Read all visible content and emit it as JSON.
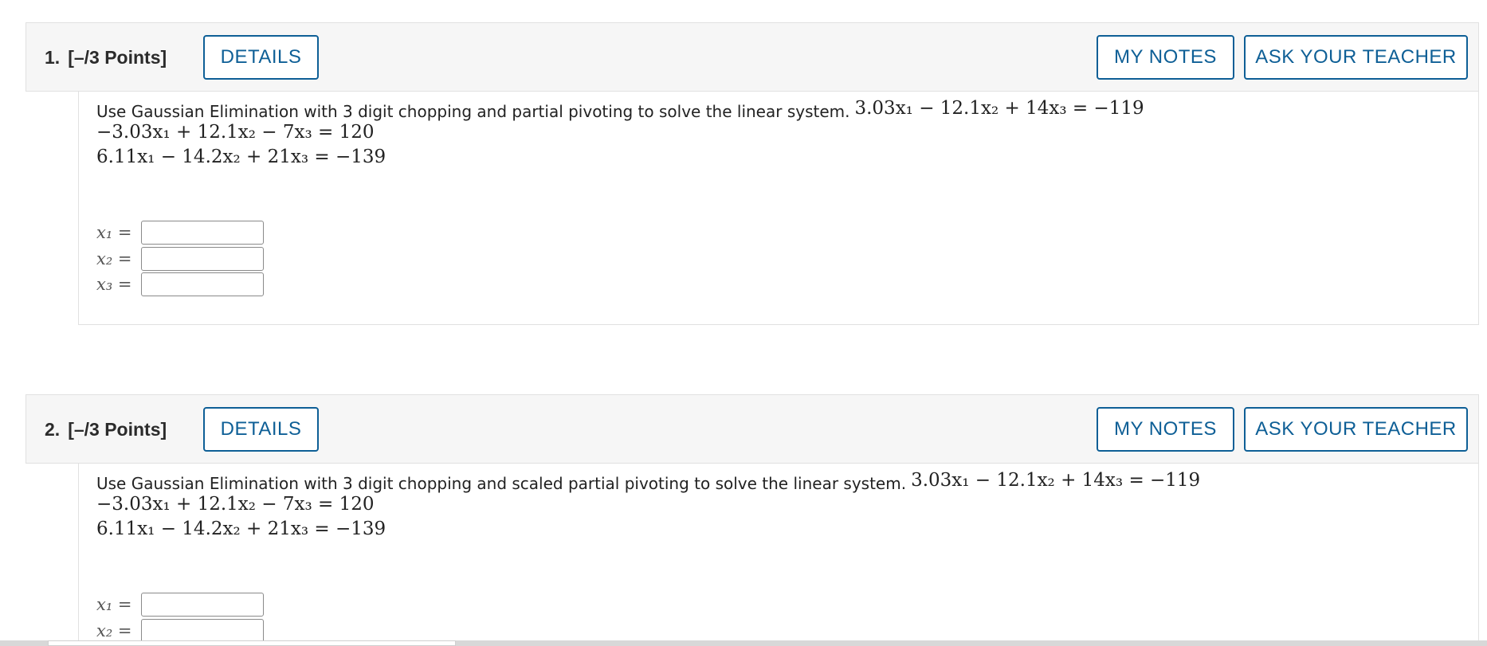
{
  "questions": [
    {
      "number": "1.",
      "points": "[–/3 Points]",
      "details_label": "DETAILS",
      "notes_label": "MY NOTES",
      "ask_label": "ASK YOUR TEACHER",
      "prompt": "Use Gaussian Elimination with 3 digit chopping and partial pivoting to solve the linear system.",
      "equations": [
        "3.03x₁ − 12.1x₂ + 14x₃ = −119",
        "−3.03x₁ + 12.1x₂ − 7x₃ = 120",
        "6.11x₁ − 14.2x₂ + 21x₃ = −139"
      ],
      "answers": [
        {
          "label": "x₁ =",
          "value": ""
        },
        {
          "label": "x₂ =",
          "value": ""
        },
        {
          "label": "x₃ =",
          "value": ""
        }
      ]
    },
    {
      "number": "2.",
      "points": "[–/3 Points]",
      "details_label": "DETAILS",
      "notes_label": "MY NOTES",
      "ask_label": "ASK YOUR TEACHER",
      "prompt": "Use Gaussian Elimination with 3 digit chopping and scaled partial pivoting to solve the linear system.",
      "equations": [
        "3.03x₁ − 12.1x₂ + 14x₃ = −119",
        "−3.03x₁ + 12.1x₂ − 7x₃ = 120",
        "6.11x₁ − 14.2x₂ + 21x₃ = −139"
      ],
      "answers": [
        {
          "label": "x₁ =",
          "value": ""
        },
        {
          "label": "x₂ =",
          "value": ""
        }
      ]
    }
  ],
  "colors": {
    "accent": "#0e5f96",
    "header_bg": "#f6f6f6",
    "border": "#e1e1e1"
  }
}
